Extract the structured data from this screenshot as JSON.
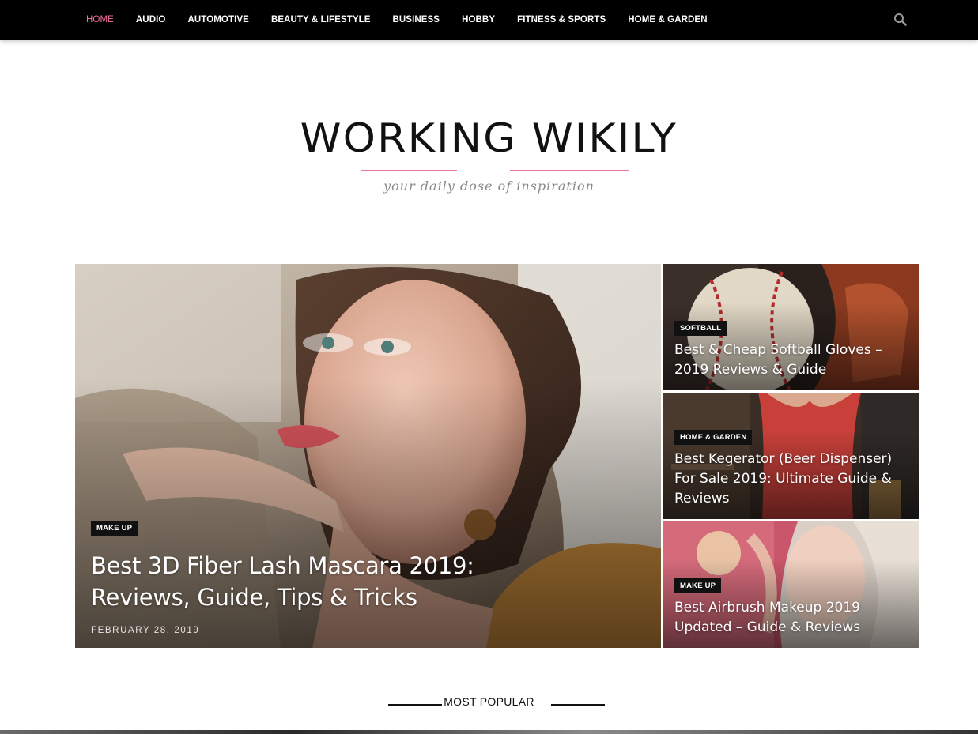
{
  "nav": {
    "items": [
      "HOME",
      "AUDIO",
      "AUTOMOTIVE",
      "BEAUTY & LIFESTYLE",
      "BUSINESS",
      "HOBBY",
      "FITNESS & SPORTS",
      "HOME & GARDEN"
    ],
    "active": "HOME",
    "active_color": "#f0709d",
    "search_icon": "search-icon"
  },
  "logo": {
    "title": "WORKING WIKILY",
    "tagline": "your daily dose of inspiration",
    "accent_color": "#e9779c"
  },
  "featured": {
    "category": "MAKE UP",
    "title": "Best 3D Fiber Lash Mascara 2019: Reviews, Guide, Tips & Tricks",
    "date": "FEBRUARY 28, 2019"
  },
  "side_posts": [
    {
      "category": "SOFTBALL",
      "title": "Best & Cheap Softball Gloves – 2019 Reviews & Guide"
    },
    {
      "category": "HOME & GARDEN",
      "title": "Best Kegerator (Beer Dispenser) For Sale 2019: Ultimate Guide & Reviews"
    },
    {
      "category": "MAKE UP",
      "title": "Best Airbrush Makeup 2019 Updated – Guide & Reviews"
    }
  ],
  "section": {
    "heading": "MOST POPULAR"
  }
}
